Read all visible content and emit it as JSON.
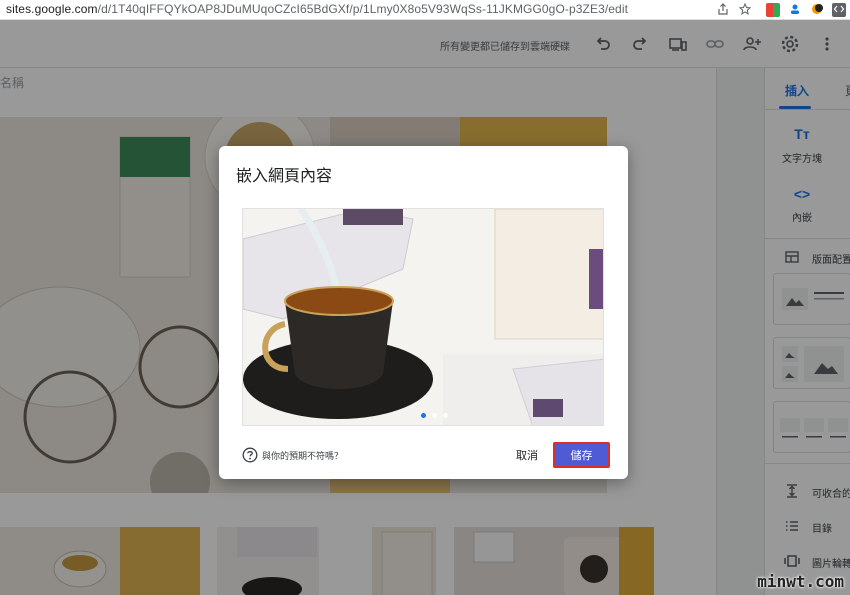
{
  "browser": {
    "url_host": "sites.google.com",
    "url_path": "/d/1T40qIFFQYkOAP8JDuMUqoCZcI65BdGXf/p/1Lmy0X8o5V93WqSs-11JKMGG0gO-p3ZE3/edit"
  },
  "header": {
    "save_status": "所有變更都已儲存到雲端硬碟"
  },
  "canvas": {
    "site_name": "名稱"
  },
  "panel": {
    "tab_insert": "插入",
    "tab_next": "頁",
    "items": [
      {
        "icon": "Tт",
        "label": "文字方塊"
      },
      {
        "icon": "<>",
        "label": "內嵌"
      }
    ],
    "layouts_label": "版面配置",
    "rows": [
      {
        "label": "可收合的"
      },
      {
        "label": "目錄"
      },
      {
        "label": "圖片輪轉"
      }
    ]
  },
  "dialog": {
    "title": "嵌入網頁內容",
    "help_text": "與你的預期不符嗎？",
    "cancel_label": "取消",
    "save_label": "儲存"
  },
  "watermark": "minwt.com",
  "colors": {
    "accent": "#1a73e8",
    "save_button": "#4f5bd5",
    "save_outline": "#d93025"
  }
}
